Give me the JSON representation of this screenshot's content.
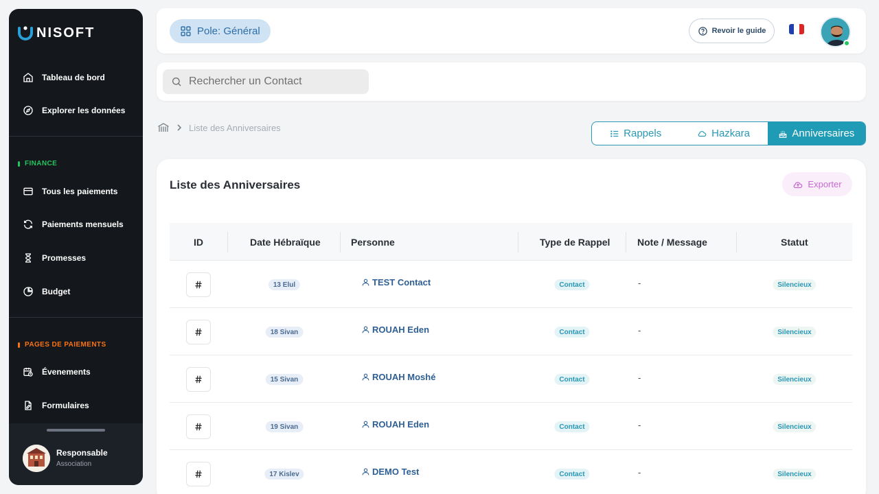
{
  "brand": {
    "logo_text": "NISOFT"
  },
  "sidebar": {
    "main_items": [
      {
        "label": "Tableau de bord",
        "icon": "home-icon"
      },
      {
        "label": "Explorer les données",
        "icon": "compass-icon"
      }
    ],
    "sections": [
      {
        "label": "FINANCE",
        "color": "#22c55e",
        "items": [
          {
            "label": "Tous les paiements",
            "icon": "card-icon"
          },
          {
            "label": "Paiements mensuels",
            "icon": "refresh-icon"
          },
          {
            "label": "Promesses",
            "icon": "hourglass-icon"
          },
          {
            "label": "Budget",
            "icon": "pie-icon"
          }
        ]
      },
      {
        "label": "PAGES DE PAIEMENTS",
        "color": "#f97316",
        "items": [
          {
            "label": "Évenements",
            "icon": "calendar-clock-icon"
          },
          {
            "label": "Formulaires",
            "icon": "file-edit-icon"
          }
        ]
      }
    ],
    "user": {
      "role": "Responsable",
      "subtitle": "Association"
    }
  },
  "topbar": {
    "pole_label": "Pole: Général",
    "guide_label": "Revoir le guide",
    "language_flag": "france-flag-icon"
  },
  "search": {
    "placeholder": "Rechercher un Contact"
  },
  "breadcrumb": {
    "current": "Liste des Anniversaires"
  },
  "tabs": [
    {
      "label": "Rappels",
      "icon": "list-icon",
      "active": false
    },
    {
      "label": "Hazkara",
      "icon": "cloud-icon",
      "active": false
    },
    {
      "label": "Anniversaires",
      "icon": "cake-icon",
      "active": true
    }
  ],
  "card": {
    "title": "Liste des Anniversaires",
    "export_label": "Exporter"
  },
  "table": {
    "columns": [
      "ID",
      "Date Hébraïque",
      "Personne",
      "Type de Rappel",
      "Note / Message",
      "Statut"
    ],
    "rows": [
      {
        "date": "13 Elul",
        "person": "TEST Contact",
        "type": "Contact",
        "note": "-",
        "status": "Silencieux"
      },
      {
        "date": "18 Sivan",
        "person": "ROUAH Eden",
        "type": "Contact",
        "note": "-",
        "status": "Silencieux"
      },
      {
        "date": "15 Sivan",
        "person": "ROUAH Moshé",
        "type": "Contact",
        "note": "-",
        "status": "Silencieux"
      },
      {
        "date": "19 Sivan",
        "person": "ROUAH Eden",
        "type": "Contact",
        "note": "-",
        "status": "Silencieux"
      },
      {
        "date": "17 Kislev",
        "person": "DEMO Test",
        "type": "Contact",
        "note": "-",
        "status": "Silencieux"
      }
    ]
  },
  "colors": {
    "accent": "#1f9bb6",
    "sidebar_bg": "#14171c",
    "link": "#2e5f94",
    "export": "#c76ad1"
  }
}
